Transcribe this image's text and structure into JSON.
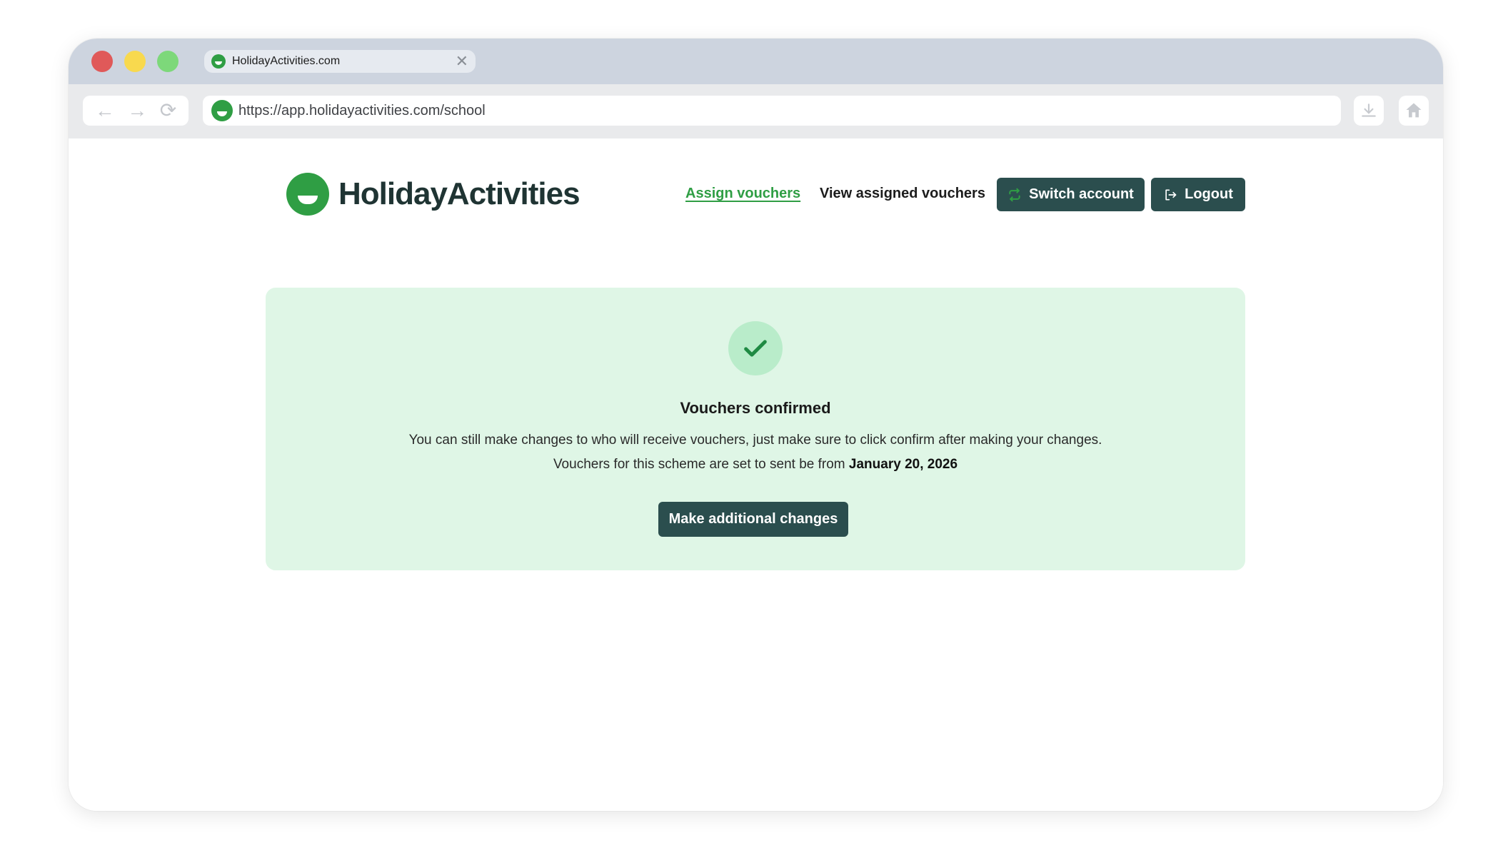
{
  "browser": {
    "tab": {
      "title": "HolidayActivities.com",
      "close_glyph": "✕",
      "favicon": "holidayactivities-logo-icon"
    },
    "url": "https://app.holidayactivities.com/school",
    "nav": {
      "back_glyph": "←",
      "forward_glyph": "→",
      "reload_glyph": "⟳"
    },
    "icons": {
      "download": "download-icon",
      "home": "home-icon"
    }
  },
  "app": {
    "brand": {
      "name": "HolidayActivities",
      "color": "#2f9e44",
      "text_color": "#1f3433"
    },
    "nav": {
      "assign_vouchers": "Assign vouchers",
      "view_assigned": "View assigned vouchers",
      "switch_account": "Switch account",
      "logout": "Logout"
    },
    "colors": {
      "dark_button": "#2b4e4e",
      "panel_bg": "#dff6e6",
      "check_bg": "#b9ecca",
      "active_link": "#2f9e44"
    }
  },
  "confirmation": {
    "title": "Vouchers confirmed",
    "message": "You can still make changes to who will receive vouchers, just make sure to click confirm after making your changes.",
    "schedule_prefix": "Vouchers for this scheme are set to sent be from ",
    "schedule_date": "January 20, 2026",
    "action_label": "Make additional changes",
    "icon": "checkmark-icon"
  }
}
